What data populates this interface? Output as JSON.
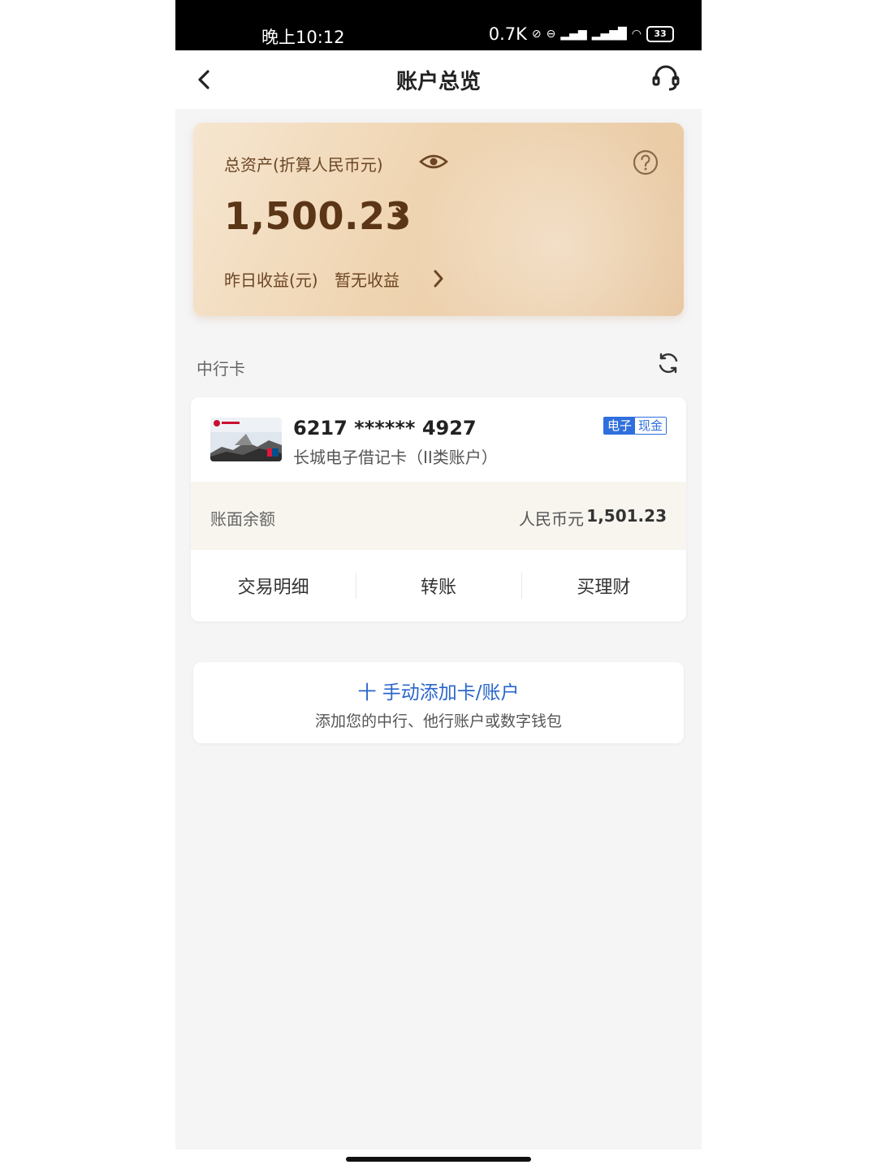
{
  "status_bar": {
    "time": "晚上10:12",
    "speed": "0.7K",
    "battery": "33"
  },
  "nav": {
    "title": "账户总览"
  },
  "assets": {
    "label": "总资产(折算人民币元)",
    "amount": "1,500.23",
    "yesterday_label": "昨日收益(元)",
    "yesterday_value": "暂无收益"
  },
  "section": {
    "title": "中行卡"
  },
  "card": {
    "number": "6217 ****** 4927",
    "type": "长城电子借记卡（II类账户）",
    "tag_a": "电子",
    "tag_b": "现金",
    "balance_label": "账面余额",
    "currency": "人民币元",
    "balance": "1,501.23",
    "actions": [
      "交易明细",
      "转账",
      "买理财"
    ]
  },
  "add_account": {
    "title": "十 手动添加卡/账户",
    "subtitle": "添加您的中行、他行账户或数字钱包"
  },
  "colors": {
    "brand_gold": "#5a3516",
    "link_blue": "#2a66cc"
  }
}
